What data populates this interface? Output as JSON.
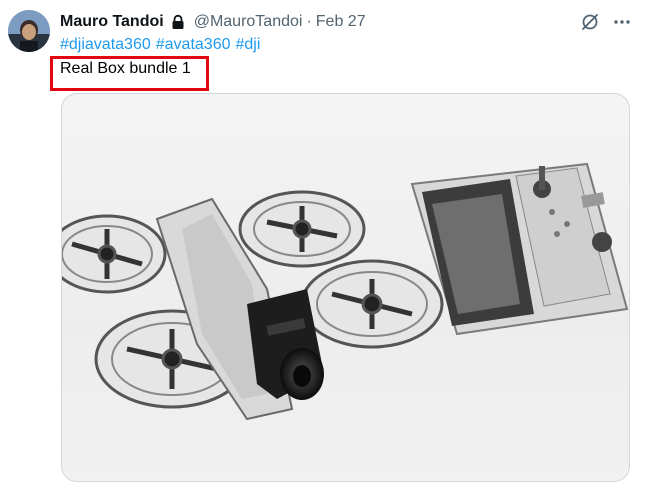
{
  "tweet": {
    "author_name": "Mauro Tandoi",
    "handle": "@MauroTandoi",
    "separator": "·",
    "date": "Feb 27",
    "hashtags": [
      "#djiavata360",
      "#avata360",
      "#dji"
    ],
    "text": "Real Box bundle 1",
    "media": {
      "description_icons": [
        "drone",
        "remote-controller"
      ]
    }
  },
  "colors": {
    "link": "#1d9bf0",
    "secondary_text": "#536471",
    "highlight": "#e1060f",
    "border": "#cfd9de"
  },
  "icons": {
    "lock": "lock-icon",
    "grok": "grok-icon",
    "more": "more-icon"
  }
}
